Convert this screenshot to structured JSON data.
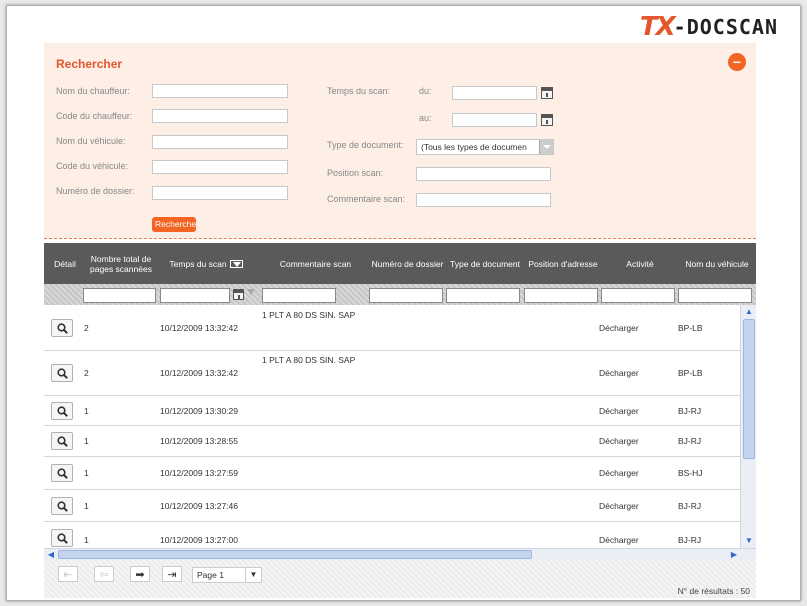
{
  "brand": {
    "tx": "TX",
    "name": "-DOCSCAN",
    "accent": "#e2572c"
  },
  "search": {
    "title": "Rechercher",
    "fields": {
      "driver_name": "Nom du chauffeur:",
      "driver_code": "Code du chauffeur:",
      "vehicle_name": "Nom du véhicule:",
      "vehicle_code": "Code du véhicule:",
      "file_number": "Numéro de dossier:",
      "scan_time": "Temps du scan:",
      "from": "du:",
      "to": "au:",
      "doc_type": "Type de document:",
      "doc_type_value": "(Tous les types de documen",
      "scan_position": "Position scan:",
      "scan_comment": "Commentaire scan:"
    },
    "button": "Rechercher"
  },
  "grid": {
    "columns": {
      "detail": "Détail",
      "pages": "Nombre total de pages scannées",
      "scan_time": "Temps du scan",
      "comment": "Commentaire scan",
      "file_number": "Numéro de dossier",
      "doc_type": "Type de document",
      "address": "Position d'adresse",
      "activity": "Activité",
      "vehicle": "Nom du véhicule"
    },
    "rows": [
      {
        "pages": "2",
        "time": "10/12/2009 13:32:42",
        "comment": "1 PLT A 80 DS SIN. SAP",
        "activity": "Décharger",
        "vehicle": "BP-LB"
      },
      {
        "pages": "2",
        "time": "10/12/2009 13:32:42",
        "comment": "1 PLT A 80 DS SIN. SAP",
        "activity": "Décharger",
        "vehicle": "BP-LB"
      },
      {
        "pages": "1",
        "time": "10/12/2009 13:30:29",
        "comment": "",
        "activity": "Décharger",
        "vehicle": "BJ-RJ"
      },
      {
        "pages": "1",
        "time": "10/12/2009 13:28:55",
        "comment": "",
        "activity": "Décharger",
        "vehicle": "BJ-RJ"
      },
      {
        "pages": "1",
        "time": "10/12/2009 13:27:59",
        "comment": "",
        "activity": "Décharger",
        "vehicle": "BS-HJ"
      },
      {
        "pages": "1",
        "time": "10/12/2009 13:27:46",
        "comment": "",
        "activity": "Décharger",
        "vehicle": "BJ-RJ"
      },
      {
        "pages": "1",
        "time": "10/12/2009 13:27:00",
        "comment": "",
        "activity": "Décharger",
        "vehicle": "BJ-RJ"
      }
    ]
  },
  "pager": {
    "page": "Page 1",
    "results": "N° de résultats : 50"
  }
}
